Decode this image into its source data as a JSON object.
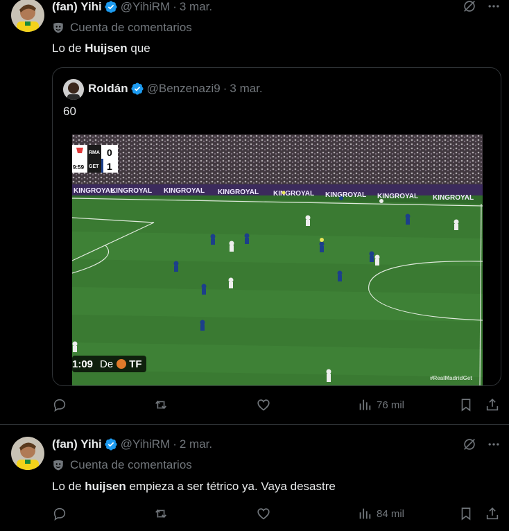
{
  "tweet1": {
    "display_name": "(fan) Yihi",
    "handle": "@YihiRM",
    "date": "3 mar.",
    "community_label": "Cuenta de comentarios",
    "text_prefix": "Lo de ",
    "text_bold": "Huijsen",
    "text_suffix": " que",
    "quote": {
      "display_name": "Roldán",
      "handle": "@Benzenazi9",
      "date": "3 mar.",
      "text": "60",
      "media": {
        "scoreboard_team1": "RMA",
        "scoreboard_team2": "GET",
        "score1": "0",
        "score2": "1",
        "match_clock": "9:59",
        "ad_text": "KINGROYAL",
        "watermark": "#RealMadridGet",
        "video_time": "1:09",
        "from_label": "De",
        "from_source": "TF"
      }
    },
    "views": "76 mil"
  },
  "tweet2": {
    "display_name": "(fan) Yihi",
    "handle": "@YihiRM",
    "date": "2 mar.",
    "community_label": "Cuenta de comentarios",
    "text_prefix": "Lo de ",
    "text_bold": "huijsen",
    "text_suffix": " empieza a ser tétrico ya. Vaya desastre",
    "views": "84 mil"
  },
  "colors": {
    "background": "#000000",
    "text": "#e7e9ea",
    "muted": "#71767b",
    "border": "#2f3336",
    "verified": "#1d9bf0",
    "pitch": "#3a7a32"
  },
  "icons": [
    "verified-icon",
    "community-icon",
    "grok-icon",
    "more-icon",
    "reply-icon",
    "repost-icon",
    "like-icon",
    "views-icon",
    "bookmark-icon",
    "share-icon"
  ]
}
